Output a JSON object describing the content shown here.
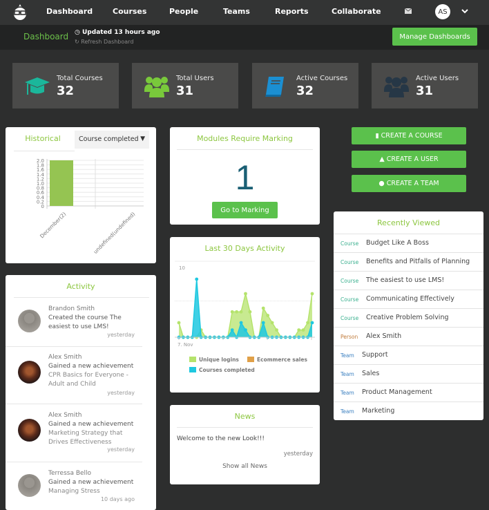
{
  "nav": {
    "items": [
      "Dashboard",
      "Courses",
      "People",
      "Teams",
      "Reports",
      "Collaborate"
    ],
    "user_initials": "AS"
  },
  "subbar": {
    "title": "Dashboard",
    "updated": "Updated 13 hours ago",
    "refresh": "Refresh Dashboard",
    "manage_label": "Manage Dashboards"
  },
  "stats": [
    {
      "label": "Total Courses",
      "value": "32",
      "icon": "graduation-cap-icon",
      "color": "#1bb79b"
    },
    {
      "label": "Total Users",
      "value": "31",
      "icon": "users-icon",
      "color": "#79c93b"
    },
    {
      "label": "Active Courses",
      "value": "32",
      "icon": "book-icon",
      "color": "#1b8fd2"
    },
    {
      "label": "Active Users",
      "value": "31",
      "icon": "users-icon",
      "color": "#263746"
    }
  ],
  "historical": {
    "title": "Historical",
    "select_value": "Course completed"
  },
  "modules": {
    "title": "Modules Require Marking",
    "count": "1",
    "button": "Go to Marking"
  },
  "activity30": {
    "title": "Last 30 Days Activity"
  },
  "news": {
    "title": "News",
    "item": "Welcome to the new Look!!!",
    "time": "yesterday",
    "show_all": "Show all News"
  },
  "activity": {
    "title": "Activity",
    "items": [
      {
        "name": "Brandon Smith",
        "action": "Created the course The easiest to use LMS!",
        "sub": "",
        "time": "yesterday",
        "avatar": "placeholder"
      },
      {
        "name": "Alex Smith",
        "action": "Gained a new achievement",
        "sub": "CPR Basics for Everyone - Adult and Child",
        "time": "yesterday",
        "avatar": "photo"
      },
      {
        "name": "Alex Smith",
        "action": "Gained a new achievement",
        "sub": "Marketing Strategy that Drives Effectiveness",
        "time": "yesterday",
        "avatar": "photo"
      },
      {
        "name": "Terressa Bello",
        "action": "Gained a new achievement",
        "sub": "Managing Stress",
        "time": "10 days ago",
        "avatar": "placeholder"
      }
    ]
  },
  "actions": {
    "create_course": "CREATE A COURSE",
    "create_user": "CREATE A USER",
    "create_team": "CREATE A TEAM"
  },
  "recent": {
    "title": "Recently Viewed",
    "items": [
      {
        "type": "Course",
        "name": "Budget Like A Boss"
      },
      {
        "type": "Course",
        "name": "Benefits and Pitfalls of Planning"
      },
      {
        "type": "Course",
        "name": "The easiest to use LMS!"
      },
      {
        "type": "Course",
        "name": "Communicating Effectively"
      },
      {
        "type": "Course",
        "name": "Creative Problem Solving"
      },
      {
        "type": "Person",
        "name": "Alex Smith"
      },
      {
        "type": "Team",
        "name": "Support"
      },
      {
        "type": "Team",
        "name": "Sales"
      },
      {
        "type": "Team",
        "name": "Product Management"
      },
      {
        "type": "Team",
        "name": "Marketing"
      }
    ],
    "type_colors": {
      "Course": "#3bb08f",
      "Person": "#c07a3a",
      "Team": "#3a7fc0"
    }
  },
  "chart_data": [
    {
      "type": "bar",
      "title": "Historical",
      "categories": [
        "December(2)",
        "undefined(undefined)"
      ],
      "values": [
        2,
        0
      ],
      "ylim": [
        0,
        2
      ],
      "yticks": [
        "0",
        "0.2",
        "0.4",
        "0.6",
        "0.8",
        "1.0",
        "1.2",
        "1.4",
        "1.6",
        "1.8",
        "2.0"
      ],
      "grid": true,
      "color": "#95c452"
    },
    {
      "type": "area",
      "title": "Last 30 Days Activity",
      "x_start_label": "7. Nov",
      "ylim": [
        0,
        10
      ],
      "ytick_label": "10",
      "grid": true,
      "legend_position": "bottom",
      "series": [
        {
          "name": "Unique logins",
          "color": "#b5e36c",
          "values": [
            2,
            0,
            0,
            0,
            0,
            1,
            0,
            0,
            0,
            0,
            0,
            0,
            3.5,
            3.5,
            3.5,
            6,
            3.5,
            0,
            0,
            4,
            3,
            2,
            1,
            0,
            0,
            0,
            0,
            1,
            1,
            2,
            6
          ]
        },
        {
          "name": "Ecommerce sales",
          "color": "#e0a048",
          "values": []
        },
        {
          "name": "Courses completed",
          "color": "#1ec8e0",
          "values": [
            0,
            0,
            0,
            0,
            8,
            0,
            0,
            0,
            0,
            0,
            0,
            0,
            1,
            0,
            2,
            1,
            0,
            0,
            0,
            2,
            0,
            0,
            0,
            0,
            0,
            0,
            0,
            0,
            0,
            0,
            2
          ]
        }
      ]
    }
  ]
}
